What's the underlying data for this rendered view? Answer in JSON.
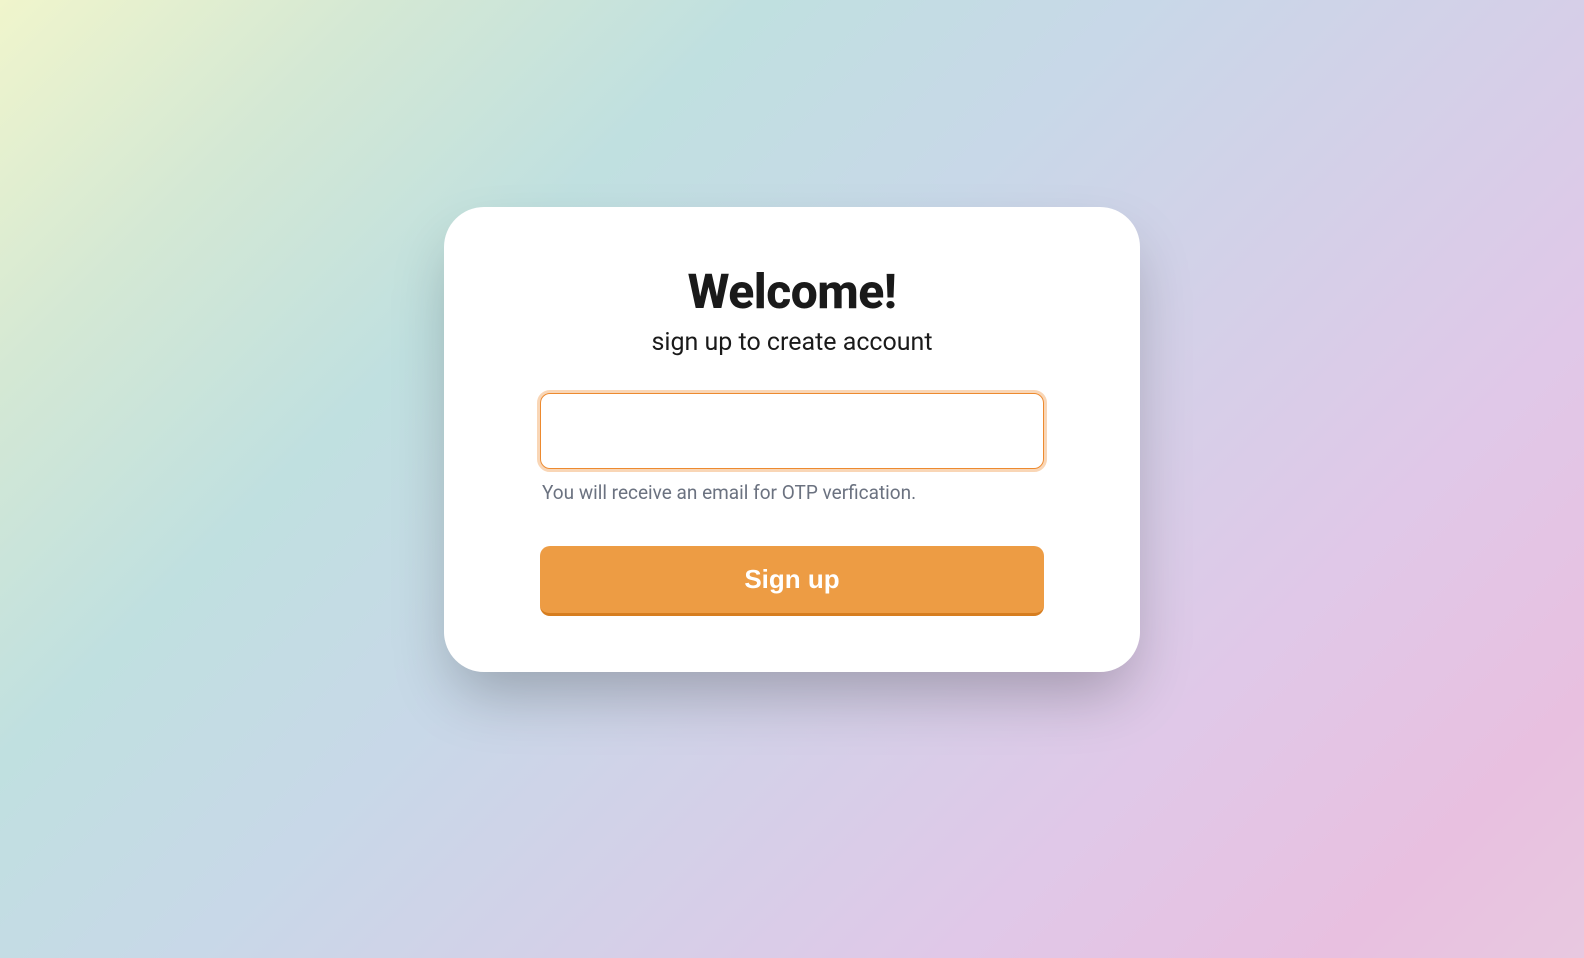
{
  "card": {
    "heading": "Welcome!",
    "subheading": "sign up to create account",
    "email_value": "",
    "helper_text": "You will receive an email for OTP verfication.",
    "signup_label": "Sign up"
  }
}
